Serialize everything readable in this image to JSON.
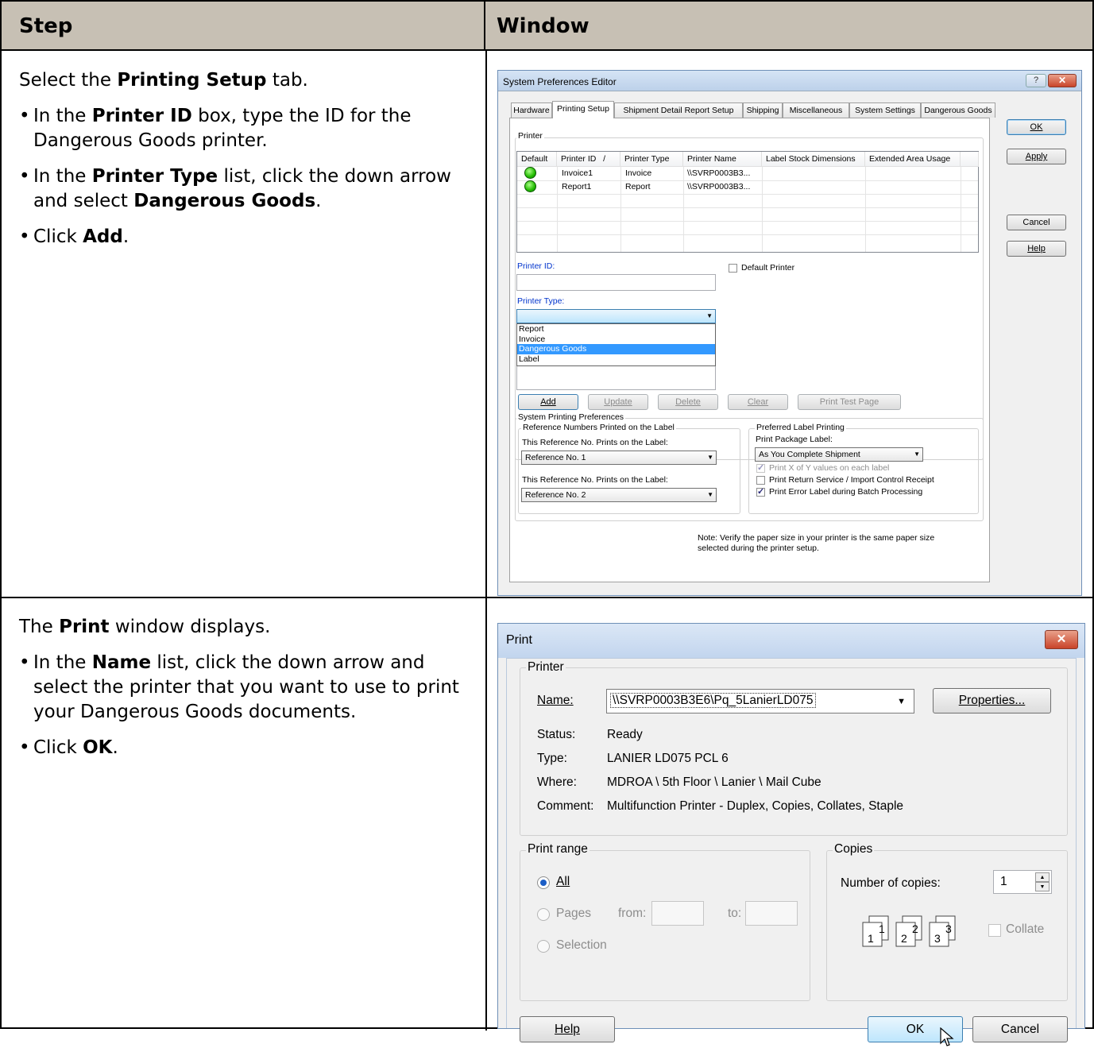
{
  "table": {
    "col_step": "Step",
    "col_window": "Window"
  },
  "row1": {
    "intro_pre": "Select the ",
    "intro_bold": "Printing Setup",
    "intro_post": " tab.",
    "b1_pre": "In the ",
    "b1_bold": "Printer ID",
    "b1_post": " box, type the ID for the Dangerous Goods printer.",
    "b2_pre": "In the ",
    "b2_bold": "Printer Type",
    "b2_mid": " list, click the down arrow and select ",
    "b2_bold2": "Dangerous Goods",
    "b2_post": ".",
    "b3_pre": "Click ",
    "b3_bold": "Add",
    "b3_post": "."
  },
  "row2": {
    "intro_pre": "The ",
    "intro_bold": "Print",
    "intro_post": " window displays.",
    "b1_pre": "In the ",
    "b1_bold": "Name",
    "b1_post": " list, click the down arrow and select the printer that you want to use to print your Dangerous Goods documents.",
    "b2_pre": "Click ",
    "b2_bold": "OK",
    "b2_post": "."
  },
  "spe": {
    "title": "System Preferences Editor",
    "help_btn": "?",
    "close_btn": "✕",
    "tabs": [
      "Hardware",
      "Printing Setup",
      "Shipment Detail Report Setup",
      "Shipping",
      "Miscellaneous",
      "System Settings",
      "Dangerous Goods"
    ],
    "ok": "OK",
    "apply": "Apply",
    "cancel": "Cancel",
    "help": "Help",
    "printer_group": "Printer",
    "columns": [
      "Default",
      "Printer ID",
      "/",
      "Printer Type",
      "Printer Name",
      "Label Stock Dimensions",
      "Extended Area Usage"
    ],
    "rows": [
      {
        "id": "Invoice1",
        "type": "Invoice",
        "name": "\\\\SVRP0003B3..."
      },
      {
        "id": "Report1",
        "type": "Report",
        "name": "\\\\SVRP0003B3..."
      }
    ],
    "printer_id_label": "Printer ID:",
    "default_printer_label": "Default Printer",
    "printer_type_label": "Printer Type:",
    "printer_type_value": "",
    "type_options": [
      "Report",
      "Invoice",
      "Dangerous Goods",
      "Label"
    ],
    "type_selected": "Dangerous Goods",
    "btn_add": "Add",
    "btn_update": "Update",
    "btn_delete": "Delete",
    "btn_clear": "Clear",
    "btn_test": "Print Test Page",
    "sys_pref_group": "System Printing Preferences",
    "ref_group": "Reference Numbers Printed on the Label",
    "ref1_label": "This Reference No. Prints on the Label:",
    "ref1_value": "Reference No. 1",
    "ref2_label": "This Reference No. Prints on the Label:",
    "ref2_value": "Reference No. 2",
    "pref_label_group": "Preferred Label Printing",
    "pkg_label": "Print Package Label:",
    "pkg_value": "As You Complete Shipment",
    "chk_xy": "Print X of Y values on each label",
    "chk_return": "Print Return Service / Import Control Receipt",
    "chk_error": "Print Error Label during Batch Processing",
    "note_line1": "Note: Verify the paper size in your printer is the same paper size",
    "note_line2": "selected during the printer setup."
  },
  "print": {
    "title": "Print",
    "close_btn": "✕",
    "printer_group": "Printer",
    "name_label": "Name:",
    "name_value": "\\\\SVRP0003B3E6\\Pq_5LanierLD075",
    "properties": "Properties...",
    "status_label": "Status:",
    "status_value": "Ready",
    "type_label": "Type:",
    "type_value": "LANIER LD075 PCL 6",
    "where_label": "Where:",
    "where_value": "MDROA \\ 5th Floor \\ Lanier \\ Mail Cube",
    "comment_label": "Comment:",
    "comment_value": "Multifunction Printer - Duplex, Copies, Collates, Staple",
    "range_group": "Print range",
    "all": "All",
    "pages": "Pages",
    "from": "from:",
    "to": "to:",
    "selection": "Selection",
    "copies_group": "Copies",
    "num_copies": "Number of copies:",
    "copies_value": "1",
    "collate": "Collate",
    "help": "Help",
    "ok": "OK",
    "cancel": "Cancel"
  }
}
